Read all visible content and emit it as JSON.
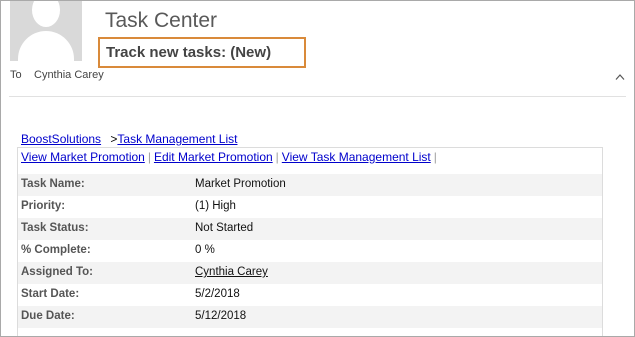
{
  "header": {
    "app_title": "Task Center",
    "subject": "Track new tasks: (New)",
    "to_label": "To",
    "recipient": "Cynthia Carey"
  },
  "icons": {
    "avatar": "person-placeholder-icon",
    "collapse": "chevron-up-icon"
  },
  "colors": {
    "subject_highlight": "#d98a3a",
    "link": "#0000cc",
    "row_shade": "#f3f3f3"
  },
  "breadcrumb": {
    "root": "BoostSolutions",
    "separator": ">",
    "list": "Task Management List"
  },
  "actions": {
    "view_item": "View Market Promotion",
    "edit_item": "Edit Market Promotion",
    "view_list": "View Task Management List",
    "pipe": "|"
  },
  "fields": [
    {
      "label": "Task Name:",
      "value": "Market Promotion"
    },
    {
      "label": "Priority:",
      "value": "(1) High"
    },
    {
      "label": "Task Status:",
      "value": "Not Started"
    },
    {
      "label": "% Complete:",
      "value": "0 %"
    },
    {
      "label": "Assigned To:",
      "value": "Cynthia Carey"
    },
    {
      "label": "Start Date:",
      "value": "5/2/2018"
    },
    {
      "label": "Due Date:",
      "value": "5/12/2018"
    }
  ]
}
